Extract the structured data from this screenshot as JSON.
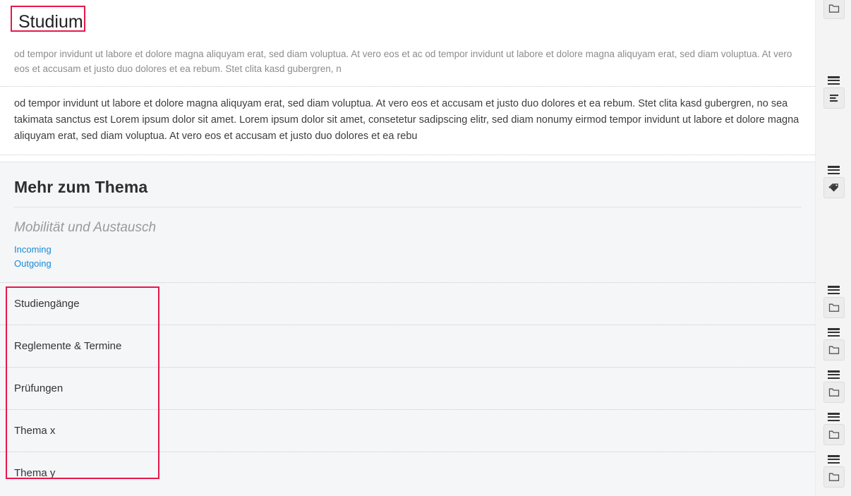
{
  "page": {
    "title": "Studium"
  },
  "lead": {
    "text": "od tempor invidunt ut labore et dolore magna aliquyam erat, sed diam voluptua. At vero eos et ac od tempor invidunt ut labore et dolore magna aliquyam erat, sed diam voluptua. At vero eos et accusam et justo duo dolores et ea rebum. Stet clita kasd gubergren, n"
  },
  "body": {
    "paragraph_1": "od tempor invidunt ut labore et dolore magna aliquyam erat, sed diam voluptua. At vero eos et accusam et justo duo dolores et ea rebum. Stet clita kasd gubergren, no sea takimata sanctus est Lorem ipsum dolor sit amet. Lorem ipsum dolor sit amet, consetetur sadipscing elitr, sed diam nonumy eirmod tempor invidunt ut labore et dolore magna aliquyam erat, sed diam voluptua. At vero eos et accusam et justo duo dolores et ea rebu",
    "paragraph_2": "od tempor invidunt ut labore et dolore magna aliquyam erat, sed diam voluptua. At vero eos et accusam et justo duo dolores et ea rebum. Stet clita kasd gubergren, no sea takimata sanctus est Lorem ipsum dolor sit amet. Lorem ipsum dolor sit amet, consetetur sadipscing elitr, sed diam nonumy eirmod tempor invidunt ut lab"
  },
  "more": {
    "heading": "Mehr zum Thema",
    "group_title": "Mobilität und Austausch",
    "links": [
      {
        "label": "Incoming"
      },
      {
        "label": "Outgoing"
      }
    ],
    "topics": [
      {
        "label": "Studiengänge"
      },
      {
        "label": "Reglemente & Termine"
      },
      {
        "label": "Prüfungen"
      },
      {
        "label": "Thema x"
      },
      {
        "label": "Thema y"
      }
    ]
  },
  "rail": {
    "items": [
      {
        "icon": "folder-icon",
        "has_handle": false
      },
      {
        "icon": "text-block-icon",
        "has_handle": true
      },
      {
        "icon": "tag-icon",
        "has_handle": true
      },
      {
        "icon": "folder-icon",
        "has_handle": true
      },
      {
        "icon": "folder-icon",
        "has_handle": true
      },
      {
        "icon": "folder-icon",
        "has_handle": true
      },
      {
        "icon": "folder-icon",
        "has_handle": true
      },
      {
        "icon": "folder-icon",
        "has_handle": true
      }
    ]
  },
  "annotations": {
    "highlight_color": "#e8174b",
    "highlighted": [
      "page-title",
      "topic-list"
    ]
  }
}
